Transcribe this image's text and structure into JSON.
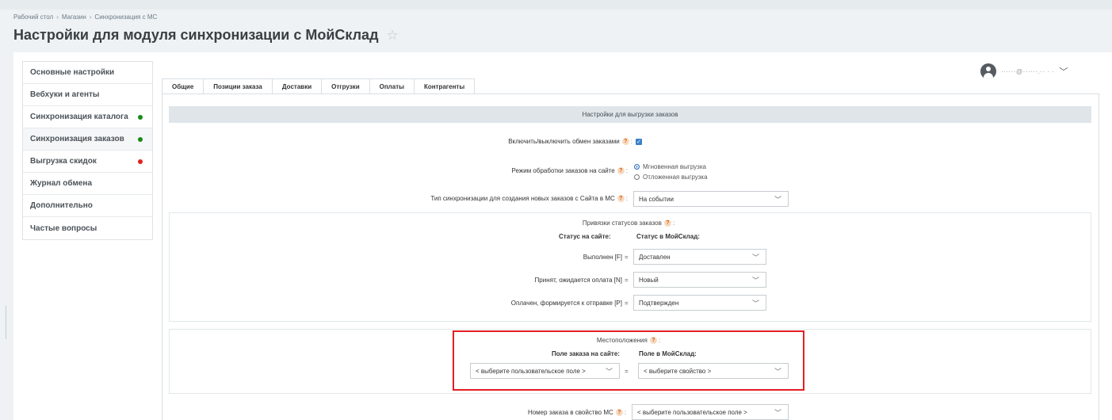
{
  "breadcrumb": [
    "Рабочий стол",
    "Магазин",
    "Синхронизация с МС"
  ],
  "page_title": "Настройки для модуля синхронизации с МойСклад",
  "sidebar": {
    "items": [
      {
        "label": "Основные настройки",
        "status": null
      },
      {
        "label": "Вебхуки и агенты",
        "status": null
      },
      {
        "label": "Синхронизация каталога",
        "status": "#1a8a1a"
      },
      {
        "label": "Синхронизация заказов",
        "status": "#1a8a1a"
      },
      {
        "label": "Выгрузка скидок",
        "status": "#e32020"
      },
      {
        "label": "Журнал обмена",
        "status": null
      },
      {
        "label": "Дополнительно",
        "status": null
      },
      {
        "label": "Частые вопросы",
        "status": null
      }
    ]
  },
  "user": {
    "name": "······@······.·· · ·"
  },
  "tabs": [
    "Общие",
    "Позиции заказа",
    "Доставки",
    "Отгрузки",
    "Оплаты",
    "Контрагенты"
  ],
  "section_header": "Настройки для выгрузки заказов",
  "fields": {
    "exchange": {
      "label": "Включить/выключить обмен заказами",
      "help": "?",
      "colon": ":",
      "checked": true
    },
    "mode": {
      "label": "Режим обработки заказов на сайте",
      "help": "?",
      "colon": ":",
      "options": [
        "Мгновенная выгрузка",
        "Отложенная выгрузка"
      ],
      "selected": 0
    },
    "sync_type": {
      "label": "Тип синхронизации для создания новых заказов с Сайта в МС",
      "help": "?",
      "colon": ":",
      "value": "На событии"
    }
  },
  "status_box": {
    "title": "Привязки статусов заказов",
    "help": "?",
    "colon": ":",
    "col_site": "Статус на сайте:",
    "col_ms": "Статус в МойСклад:",
    "rows": [
      {
        "site": "Выполнен [F]",
        "eq": "=",
        "ms": "Доставлен"
      },
      {
        "site": "Принят, ожидается оплата [N]",
        "eq": "=",
        "ms": "Новый"
      },
      {
        "site": "Оплачен, формируется к отправке [P]",
        "eq": "=",
        "ms": "Подтвержден"
      }
    ]
  },
  "location_box": {
    "title": "Местоположения",
    "help": "?",
    "colon": ":",
    "col_site": "Поле заказа на сайте:",
    "col_ms": "Поле в МойСклад:",
    "site_value": "< выберите пользовательское поле >",
    "eq": "=",
    "ms_value": "< выберите свойство >"
  },
  "order_number": {
    "label": "Номер заказа в свойство МС",
    "help": "?",
    "colon": ":",
    "value": "< выберите пользовательское поле >"
  },
  "colors": {
    "accent": "#3c80c8",
    "highlight": "#e31e24",
    "header_bg": "#dfe5e9"
  }
}
